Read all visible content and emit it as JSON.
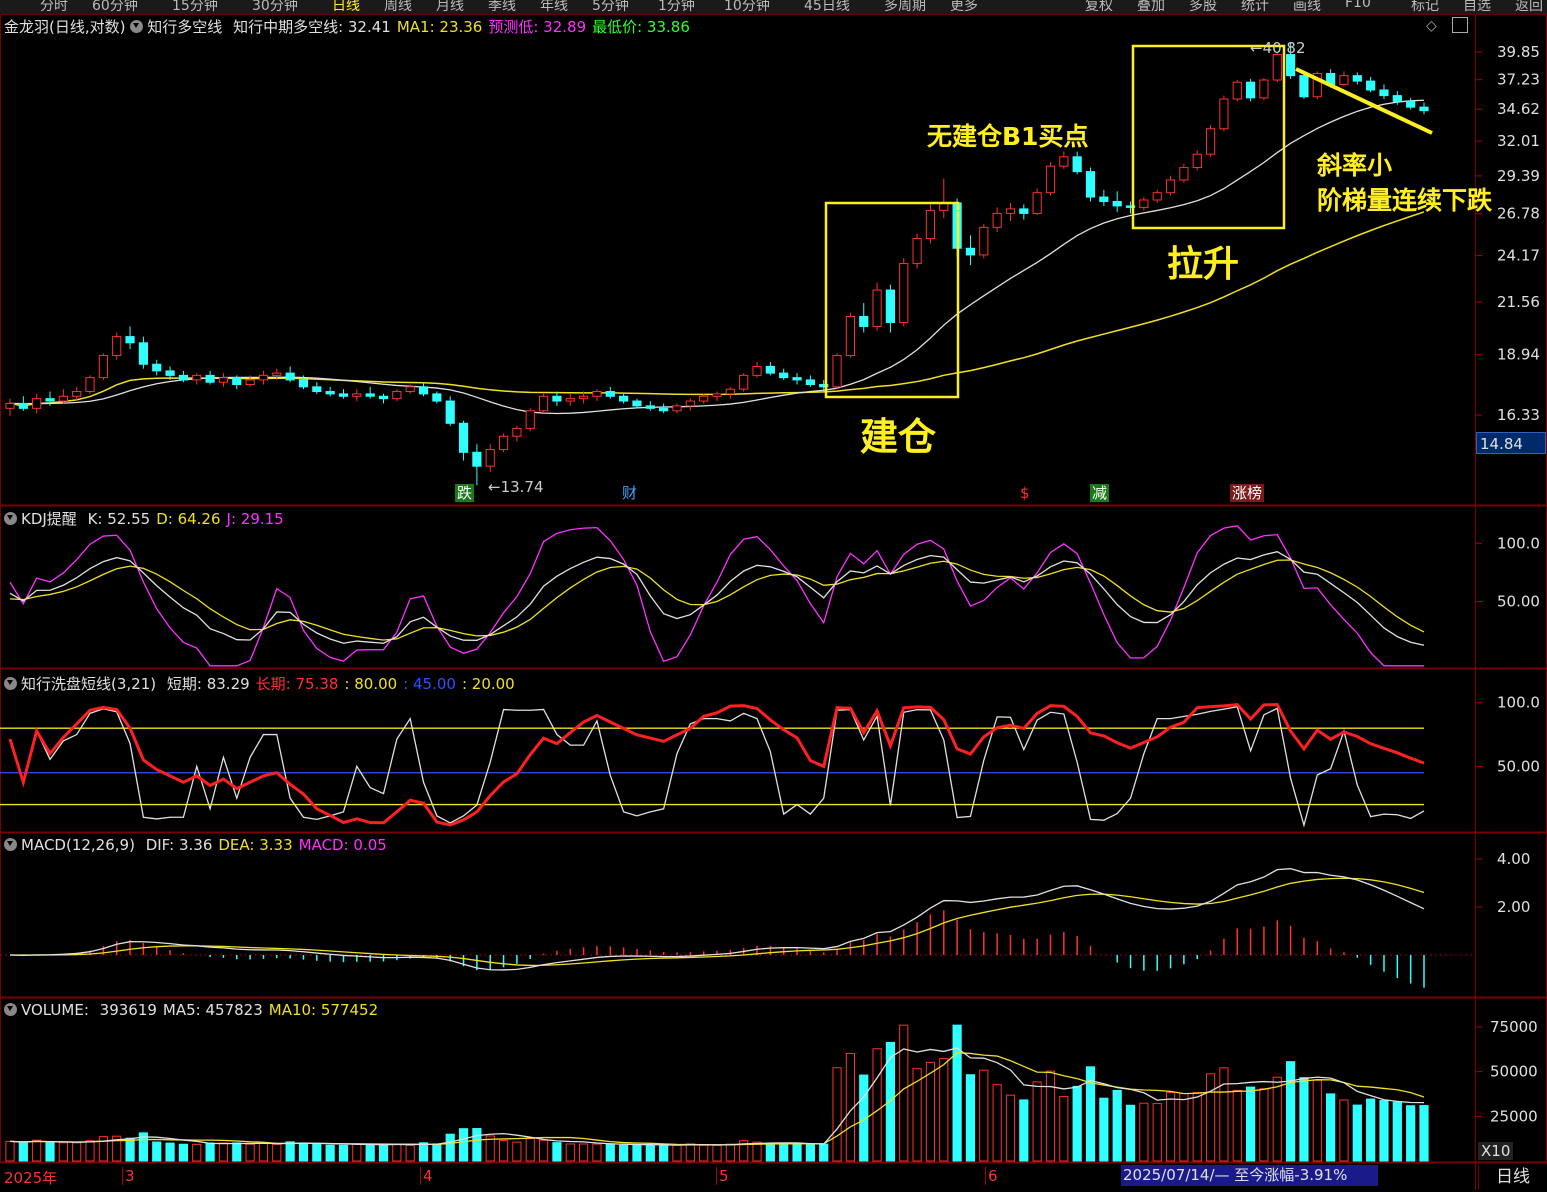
{
  "toolbar": {
    "tabs": [
      "分时",
      "60分钟",
      "15分钟",
      "30分钟",
      "日线",
      "周线",
      "月线",
      "季线",
      "年线",
      "5分钟",
      "1分钟",
      "10分钟",
      "45日线",
      "多周期",
      "更多"
    ],
    "right_tabs": [
      "复权",
      "叠加",
      "多股",
      "统计",
      "画线",
      "F10",
      "标记",
      "自选",
      "返回"
    ]
  },
  "main": {
    "stock_name": "金龙羽(日线,对数)",
    "indicator_name": "知行多空线",
    "readouts": [
      {
        "label": "知行中期多空线:",
        "value": "32.41",
        "color": "#e0e0e0"
      },
      {
        "label": "MA1:",
        "value": "23.36",
        "color": "#f0e020"
      },
      {
        "label": "预测低:",
        "value": "32.89",
        "color": "#ff30ff"
      },
      {
        "label": "最低价:",
        "value": "33.86",
        "color": "#30ff30"
      }
    ],
    "price_axis": [
      "39.85",
      "37.23",
      "34.62",
      "32.01",
      "29.39",
      "26.78",
      "24.17",
      "21.56",
      "18.94",
      "16.33"
    ],
    "current_price_tag": "14.84",
    "high_marker": "40.82",
    "low_marker": "13.74",
    "event_badges": [
      {
        "text": "跌",
        "bg": "#1a7a1a",
        "fg": "#ffffff"
      },
      {
        "text": "财",
        "bg": "#000",
        "fg": "#4aa3ff"
      },
      {
        "text": "$",
        "bg": "#000",
        "fg": "#ff3030"
      },
      {
        "text": "减",
        "bg": "#1a7a1a",
        "fg": "#ffffff"
      },
      {
        "text": "涨榜",
        "bg": "#7a1a1a",
        "fg": "#ffffff"
      }
    ]
  },
  "annotations": {
    "build": "建仓",
    "no_build": "无建仓B1买点",
    "rally": "拉升",
    "slope_line1": "斜率小",
    "slope_line2": "阶梯量连续下跌"
  },
  "kdj": {
    "title": "KDJ提醒",
    "readouts": [
      {
        "label": "K:",
        "value": "52.55",
        "color": "#e0e0e0"
      },
      {
        "label": "D:",
        "value": "64.26",
        "color": "#f0e020"
      },
      {
        "label": "J:",
        "value": "29.15",
        "color": "#ff30ff"
      }
    ],
    "axis": [
      "100.0",
      "50.00"
    ]
  },
  "wash": {
    "title": "知行洗盘短线(3,21)",
    "readouts": [
      {
        "label": "短期:",
        "value": "83.29",
        "color": "#e0e0e0"
      },
      {
        "label": "长期:",
        "value": "75.38",
        "color": "#ff3030"
      },
      {
        "label": ":",
        "value": "80.00",
        "color": "#f0e020"
      },
      {
        "label": ":",
        "value": "45.00",
        "color": "#3050ff"
      },
      {
        "label": ":",
        "value": "20.00",
        "color": "#f0e020"
      }
    ],
    "axis": [
      "100.0",
      "50.00"
    ]
  },
  "macd": {
    "title": "MACD(12,26,9)",
    "readouts": [
      {
        "label": "DIF:",
        "value": "3.36",
        "color": "#e0e0e0"
      },
      {
        "label": "DEA:",
        "value": "3.33",
        "color": "#f0e020"
      },
      {
        "label": "MACD:",
        "value": "0.05",
        "color": "#ff30ff"
      }
    ],
    "axis": [
      "4.00",
      "2.00"
    ]
  },
  "volume": {
    "title": "VOLUME:",
    "readouts": [
      {
        "label": "",
        "value": "393619",
        "color": "#e0e0e0"
      },
      {
        "label": "MA5:",
        "value": "457823",
        "color": "#e0e0e0"
      },
      {
        "label": "MA10:",
        "value": "577452",
        "color": "#f0e020"
      }
    ],
    "axis": [
      "75000",
      "50000",
      "25000"
    ],
    "unit": "X10"
  },
  "date_axis": {
    "year": "2025年",
    "months": [
      "3",
      "4",
      "5",
      "6"
    ],
    "range_tag": "2025/07/14/— 至今涨幅-3.91%",
    "period": "日线"
  },
  "colors": {
    "up": "#ff3030",
    "down": "#30ffff",
    "ma_white": "#e0e0e0",
    "ma_yellow": "#f0e020",
    "grid": "#7a0000",
    "annotation": "#ffef20"
  },
  "chart_data": {
    "type": "candlestick",
    "title": "金龙羽(日线,对数)",
    "dates_shown": [
      "2025年",
      "3",
      "4",
      "5",
      "6"
    ],
    "y_axis_ticks": [
      39.85,
      37.23,
      34.62,
      32.01,
      29.39,
      26.78,
      24.17,
      21.56,
      18.94,
      16.33
    ],
    "ohlc": [
      [
        16.6,
        17.0,
        16.3,
        16.8
      ],
      [
        16.8,
        17.1,
        16.5,
        16.6
      ],
      [
        16.6,
        17.2,
        16.4,
        17.0
      ],
      [
        17.0,
        17.3,
        16.7,
        16.9
      ],
      [
        16.9,
        17.4,
        16.8,
        17.1
      ],
      [
        17.1,
        17.5,
        16.9,
        17.3
      ],
      [
        17.3,
        18.0,
        17.2,
        17.9
      ],
      [
        17.9,
        19.0,
        17.8,
        18.9
      ],
      [
        18.9,
        20.0,
        18.7,
        19.8
      ],
      [
        19.8,
        20.3,
        19.2,
        19.5
      ],
      [
        19.5,
        19.8,
        18.3,
        18.5
      ],
      [
        18.5,
        18.7,
        18.0,
        18.2
      ],
      [
        18.2,
        18.4,
        17.8,
        18.0
      ],
      [
        18.0,
        18.2,
        17.7,
        17.8
      ],
      [
        17.8,
        18.1,
        17.6,
        18.0
      ],
      [
        18.0,
        18.2,
        17.6,
        17.7
      ],
      [
        17.7,
        18.1,
        17.5,
        17.9
      ],
      [
        17.9,
        18.0,
        17.4,
        17.6
      ],
      [
        17.6,
        18.0,
        17.5,
        17.8
      ],
      [
        17.8,
        18.2,
        17.6,
        18.0
      ],
      [
        18.0,
        18.3,
        17.8,
        18.1
      ],
      [
        18.1,
        18.4,
        17.7,
        17.8
      ],
      [
        17.8,
        18.0,
        17.4,
        17.5
      ],
      [
        17.5,
        17.7,
        17.2,
        17.3
      ],
      [
        17.3,
        17.5,
        17.1,
        17.2
      ],
      [
        17.2,
        17.4,
        17.0,
        17.1
      ],
      [
        17.1,
        17.4,
        16.9,
        17.2
      ],
      [
        17.2,
        17.5,
        17.0,
        17.1
      ],
      [
        17.1,
        17.2,
        16.8,
        17.0
      ],
      [
        17.0,
        17.4,
        16.9,
        17.3
      ],
      [
        17.3,
        17.6,
        17.2,
        17.5
      ],
      [
        17.5,
        17.7,
        17.1,
        17.2
      ],
      [
        17.2,
        17.3,
        16.8,
        16.9
      ],
      [
        16.9,
        17.1,
        15.9,
        16.0
      ],
      [
        16.0,
        16.1,
        14.6,
        14.9
      ],
      [
        14.9,
        15.2,
        13.74,
        14.4
      ],
      [
        14.4,
        15.2,
        14.2,
        15.0
      ],
      [
        15.0,
        15.6,
        14.9,
        15.5
      ],
      [
        15.5,
        15.9,
        15.3,
        15.8
      ],
      [
        15.8,
        16.6,
        15.7,
        16.5
      ],
      [
        16.5,
        17.2,
        16.4,
        17.1
      ],
      [
        17.1,
        17.3,
        16.7,
        16.9
      ],
      [
        16.9,
        17.2,
        16.7,
        17.0
      ],
      [
        17.0,
        17.3,
        16.8,
        17.1
      ],
      [
        17.1,
        17.4,
        16.9,
        17.3
      ],
      [
        17.3,
        17.5,
        17.0,
        17.1
      ],
      [
        17.1,
        17.2,
        16.8,
        16.9
      ],
      [
        16.9,
        17.0,
        16.6,
        16.7
      ],
      [
        16.7,
        16.9,
        16.5,
        16.6
      ],
      [
        16.6,
        16.8,
        16.4,
        16.5
      ],
      [
        16.5,
        16.8,
        16.4,
        16.7
      ],
      [
        16.7,
        17.0,
        16.5,
        16.9
      ],
      [
        16.9,
        17.2,
        16.8,
        17.1
      ],
      [
        17.1,
        17.3,
        16.9,
        17.2
      ],
      [
        17.2,
        17.5,
        17.0,
        17.4
      ],
      [
        17.4,
        18.1,
        17.3,
        18.0
      ],
      [
        18.0,
        18.6,
        17.9,
        18.4
      ],
      [
        18.4,
        18.6,
        18.0,
        18.1
      ],
      [
        18.1,
        18.3,
        17.8,
        17.9
      ],
      [
        17.9,
        18.1,
        17.6,
        17.8
      ],
      [
        17.8,
        18.0,
        17.5,
        17.6
      ],
      [
        17.6,
        17.8,
        17.3,
        17.5
      ],
      [
        17.5,
        19.0,
        17.4,
        18.9
      ],
      [
        18.9,
        21.0,
        18.8,
        20.8
      ],
      [
        20.8,
        21.5,
        20.0,
        20.3
      ],
      [
        20.3,
        22.6,
        20.1,
        22.2
      ],
      [
        22.2,
        22.5,
        20.0,
        20.5
      ],
      [
        20.5,
        24.0,
        20.3,
        23.7
      ],
      [
        23.7,
        25.5,
        23.4,
        25.2
      ],
      [
        25.2,
        27.4,
        24.9,
        27.0
      ],
      [
        27.0,
        29.2,
        26.5,
        27.5
      ],
      [
        27.5,
        27.8,
        24.1,
        24.6
      ],
      [
        24.6,
        25.4,
        23.6,
        24.2
      ],
      [
        24.2,
        26.1,
        24.0,
        25.9
      ],
      [
        25.9,
        27.2,
        25.6,
        26.8
      ],
      [
        26.8,
        27.5,
        26.3,
        27.1
      ],
      [
        27.1,
        27.4,
        26.4,
        26.8
      ],
      [
        26.8,
        28.5,
        26.7,
        28.2
      ],
      [
        28.2,
        30.4,
        28.0,
        30.1
      ],
      [
        30.1,
        31.2,
        29.9,
        30.8
      ],
      [
        30.8,
        31.2,
        29.5,
        29.7
      ],
      [
        29.7,
        30.0,
        27.6,
        27.9
      ],
      [
        27.9,
        28.4,
        27.3,
        27.6
      ],
      [
        27.6,
        28.3,
        26.9,
        27.3
      ],
      [
        27.3,
        27.6,
        26.8,
        27.2
      ],
      [
        27.2,
        27.9,
        27.0,
        27.7
      ],
      [
        27.7,
        28.4,
        27.5,
        28.2
      ],
      [
        28.2,
        29.4,
        28.0,
        29.1
      ],
      [
        29.1,
        30.3,
        28.9,
        30.0
      ],
      [
        30.0,
        31.3,
        29.8,
        31.0
      ],
      [
        31.0,
        33.3,
        30.8,
        33.0
      ],
      [
        33.0,
        35.8,
        32.8,
        35.5
      ],
      [
        35.5,
        37.2,
        35.3,
        37.0
      ],
      [
        37.0,
        37.3,
        35.3,
        35.6
      ],
      [
        35.6,
        37.4,
        35.4,
        37.2
      ],
      [
        37.2,
        39.8,
        37.0,
        39.6
      ],
      [
        39.6,
        40.82,
        37.3,
        37.6
      ],
      [
        37.6,
        38.0,
        35.5,
        35.7
      ],
      [
        35.7,
        38.0,
        35.5,
        37.8
      ],
      [
        37.8,
        38.2,
        36.5,
        36.8
      ],
      [
        36.8,
        38.0,
        36.6,
        37.6
      ],
      [
        37.6,
        37.9,
        36.8,
        37.1
      ],
      [
        37.1,
        37.5,
        36.1,
        36.3
      ],
      [
        36.3,
        36.8,
        35.5,
        35.8
      ],
      [
        35.8,
        36.2,
        35.0,
        35.3
      ],
      [
        35.3,
        35.6,
        34.6,
        34.8
      ],
      [
        34.8,
        35.2,
        34.2,
        34.5
      ]
    ],
    "ma_white_endpoints": {
      "start": 16.5,
      "end": 35.2
    },
    "ma_yellow_endpoints": {
      "start": 16.9,
      "end": 26.5
    }
  }
}
